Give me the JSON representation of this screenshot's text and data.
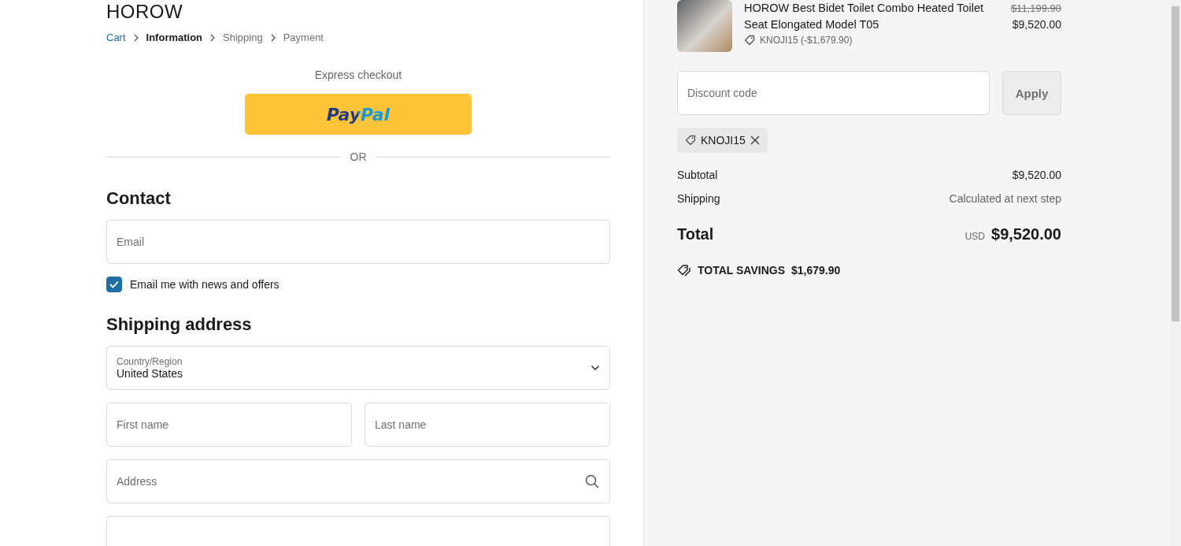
{
  "store": {
    "logo": "HOROW"
  },
  "breadcrumbs": [
    {
      "label": "Cart",
      "kind": "link"
    },
    {
      "label": "Information",
      "kind": "current"
    },
    {
      "label": "Shipping",
      "kind": "upcoming"
    },
    {
      "label": "Payment",
      "kind": "upcoming"
    }
  ],
  "express_checkout": {
    "title": "Express checkout",
    "button": "PayPal",
    "divider": "OR"
  },
  "contact": {
    "heading": "Contact",
    "email_placeholder": "Email",
    "newsletter": {
      "label": "Email me with news and offers",
      "checked": true
    }
  },
  "shipping_address": {
    "heading": "Shipping address",
    "country": {
      "label": "Country/Region",
      "value": "United States"
    },
    "first_name_placeholder": "First name",
    "last_name_placeholder": "Last name",
    "address_placeholder": "Address"
  },
  "order_summary": {
    "product": {
      "title": "HOROW Best Bidet Toilet Combo Heated Toilet Seat Elongated Model T05",
      "original_price": "$11,199.90",
      "price": "$9,520.00",
      "discount": "KNOJI15 (-$1,679.90)"
    },
    "discount_placeholder": "Discount code",
    "apply_button": "Apply",
    "applied_code": "KNOJI15",
    "lines": [
      {
        "label": "Subtotal",
        "value": "$9,520.00",
        "kind": "amount"
      },
      {
        "label": "Shipping",
        "value": "Calculated at next step",
        "kind": "note"
      }
    ],
    "total": {
      "label": "Total",
      "currency": "USD",
      "value": "$9,520.00"
    },
    "savings": {
      "label": "TOTAL SAVINGS",
      "value": "$1,679.90"
    }
  }
}
